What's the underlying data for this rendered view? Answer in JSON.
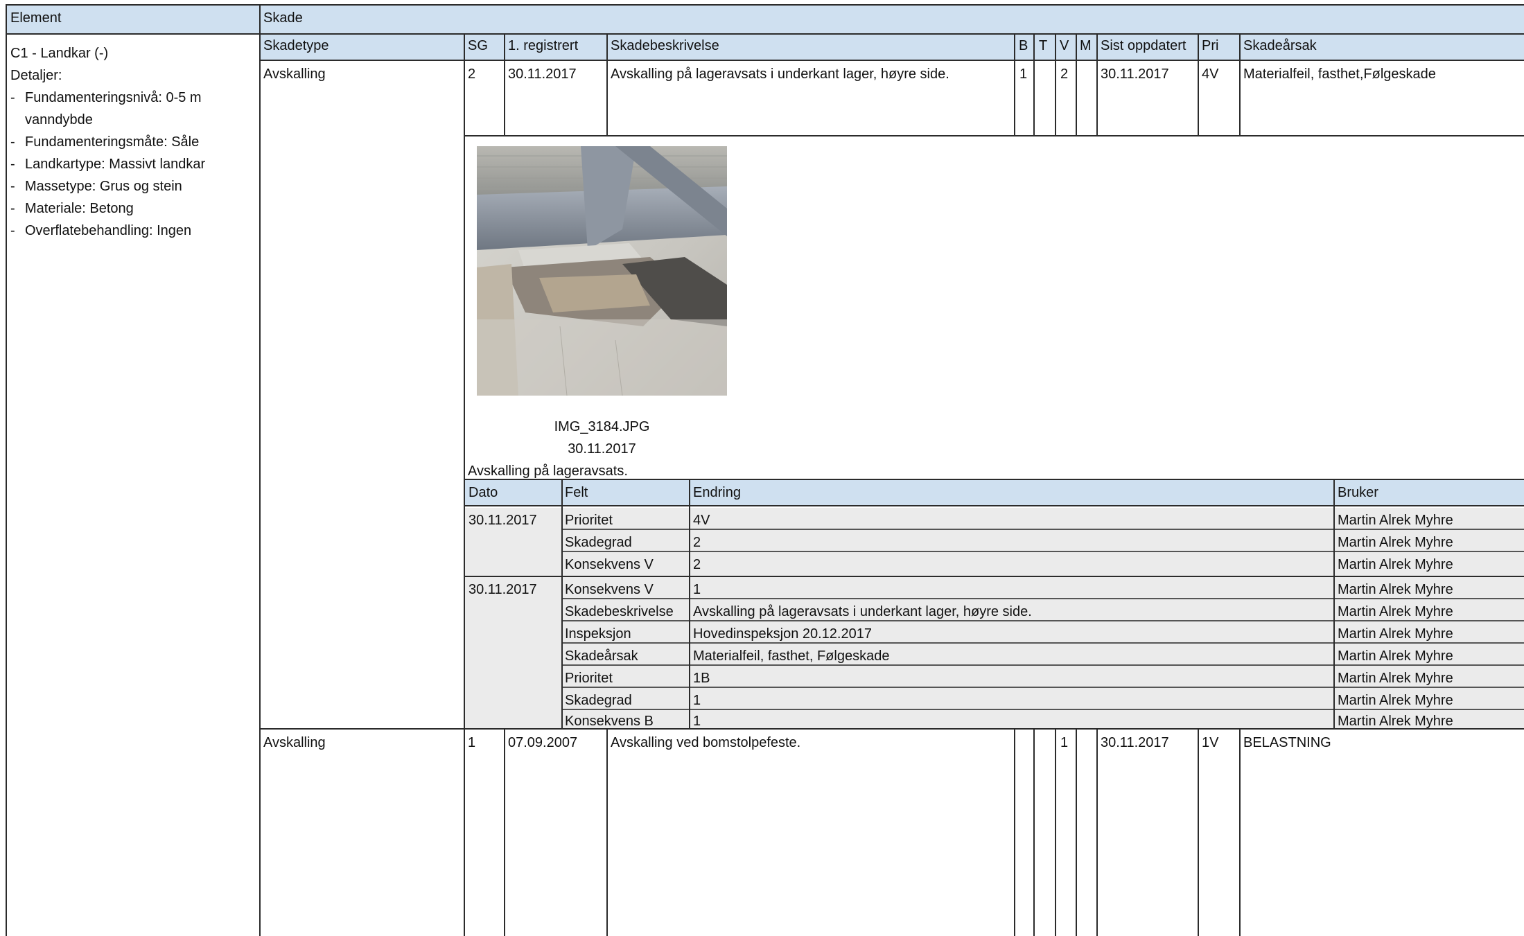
{
  "header": {
    "element": "Element",
    "skade": "Skade"
  },
  "element_info": {
    "name": "C1 - Landkar (-)",
    "details_label": "Detaljer:",
    "details": [
      {
        "line1": "Fundamenteringsnivå: 0-5 m",
        "line2": "vanndybde"
      },
      {
        "line1": "Fundamenteringsmåte: Såle"
      },
      {
        "line1": "Landkartype: Massivt landkar"
      },
      {
        "line1": "Massetype: Grus og stein"
      },
      {
        "line1": "Materiale: Betong"
      },
      {
        "line1": "Overflatebehandling: Ingen"
      }
    ]
  },
  "damage_columns": {
    "skadetype": "Skadetype",
    "sg": "SG",
    "registered": "1. registrert",
    "description": "Skadebeskrivelse",
    "b": "B",
    "t": "T",
    "v": "V",
    "m": "M",
    "updated": "Sist oppdatert",
    "pri": "Pri",
    "cause": "Skadeårsak"
  },
  "damages": [
    {
      "type": "Avskalling",
      "sg": "2",
      "registered": "30.11.2017",
      "description": "Avskalling på lageravsats i underkant lager, høyre side.",
      "b": "1",
      "t": "",
      "v": "2",
      "m": "",
      "updated": "30.11.2017",
      "pri": "4V",
      "cause": "Materialfeil, fasthet,Følgeskade"
    },
    {
      "type": "Avskalling",
      "sg": "1",
      "registered": "07.09.2007",
      "description": "Avskalling ved bomstolpefeste.",
      "b": "",
      "t": "",
      "v": "1",
      "m": "",
      "updated": "30.11.2017",
      "pri": "1V",
      "cause": "BELASTNING"
    }
  ],
  "photo": {
    "filename": "IMG_3184.JPG",
    "date": "30.11.2017",
    "caption": "Avskalling på lageravsats."
  },
  "history_columns": {
    "dato": "Dato",
    "felt": "Felt",
    "endring": "Endring",
    "bruker": "Bruker"
  },
  "history_groups": [
    {
      "date": "30.11.2017",
      "rows": [
        {
          "field": "Prioritet",
          "change": "4V",
          "user": "Martin Alrek Myhre"
        },
        {
          "field": "Skadegrad",
          "change": "2",
          "user": "Martin Alrek Myhre"
        },
        {
          "field": "Konsekvens V",
          "change": "2",
          "user": "Martin Alrek Myhre"
        }
      ]
    },
    {
      "date": "30.11.2017",
      "rows": [
        {
          "field": "Konsekvens V",
          "change": "1",
          "user": "Martin Alrek Myhre"
        },
        {
          "field": "Skadebeskrivelse",
          "change": "Avskalling på lageravsats i underkant lager, høyre side.",
          "user": "Martin Alrek Myhre"
        },
        {
          "field": "Inspeksjon",
          "change": "Hovedinspeksjon 20.12.2017",
          "user": "Martin Alrek Myhre"
        },
        {
          "field": "Skadeårsak",
          "change": "Materialfeil, fasthet, Følgeskade",
          "user": "Martin Alrek Myhre"
        },
        {
          "field": "Prioritet",
          "change": "1B",
          "user": "Martin Alrek Myhre"
        },
        {
          "field": "Skadegrad",
          "change": "1",
          "user": "Martin Alrek Myhre"
        },
        {
          "field": "Konsekvens B",
          "change": "1",
          "user": "Martin Alrek Myhre"
        }
      ]
    }
  ]
}
